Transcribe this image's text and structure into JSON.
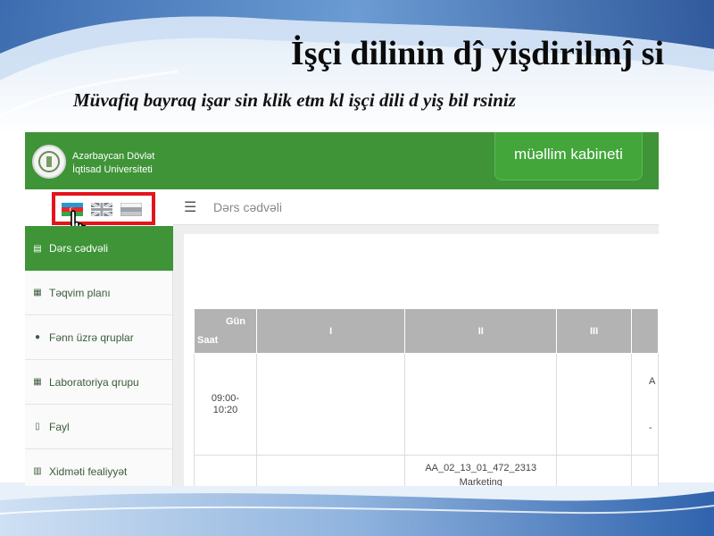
{
  "slide": {
    "title": "İşçi dilinin dĵ yişdirilmĵ si",
    "subtitle": "Müvafiq bayraq işar   sin    klik etm   kl    işçi dili d   yiş    bil   rsiniz"
  },
  "header": {
    "university_line1": "Azərbaycan Dövlət",
    "university_line2": "İqtisad Universiteti",
    "cabinet_button": "müəllim kabineti"
  },
  "languages": [
    {
      "name": "az-flag-icon"
    },
    {
      "name": "uk-flag-icon"
    },
    {
      "name": "ru-flag-icon"
    }
  ],
  "sidebar": {
    "items": [
      {
        "label": "Dərs cədvəli",
        "icon": "table-icon",
        "active": true
      },
      {
        "label": "Təqvim planı",
        "icon": "calendar-icon"
      },
      {
        "label": "Fənn üzrə qruplar",
        "icon": "users-icon"
      },
      {
        "label": "Laboratoriya qrupu",
        "icon": "grid-icon"
      },
      {
        "label": "Fayl",
        "icon": "file-icon"
      },
      {
        "label": "Xidməti fealiyyət",
        "icon": "bar-chart-icon"
      }
    ]
  },
  "main": {
    "heading": "Dərs cədvəli",
    "table": {
      "corner_day": "Gün",
      "corner_hour": "Saat",
      "columns": [
        "I",
        "II",
        "III"
      ],
      "rows": [
        {
          "time_start": "09:00-",
          "time_end": "10:20",
          "cells": [
            "",
            "",
            "",
            "A"
          ],
          "extra": "-"
        },
        {
          "time": "",
          "cells": [
            "",
            "AA_02_13_01_472_2313",
            "",
            ""
          ],
          "sub": "Marketing"
        }
      ]
    }
  },
  "colors": {
    "brand_green": "#3e9437",
    "highlight_red": "#e3141b",
    "table_header": "#b3b3b3"
  }
}
